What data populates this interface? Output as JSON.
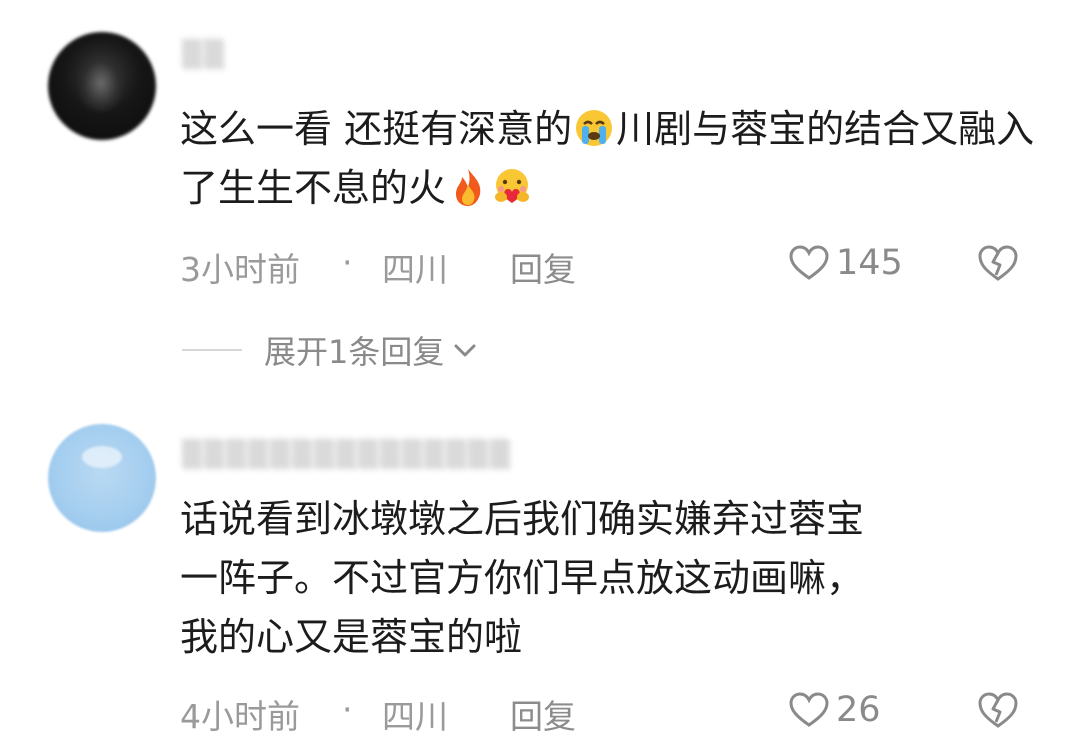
{
  "comments": [
    {
      "username": "▒▒",
      "text": [
        "这么一看 还挺有深意的",
        "川剧与蓉宝的结合又融入了生生不息的火",
        ""
      ],
      "emojis": [
        "crying-face-emoji",
        "fire-emoji",
        "heart-hug-emoji"
      ],
      "time": "3小时前",
      "separator": "·",
      "region": "四川",
      "reply_label": "回复",
      "likes": "145",
      "expand_label": "展开1条回复"
    },
    {
      "username": "▒▒▒▒▒▒▒▒▒▒▒▒▒▒▒",
      "text_lines": [
        "话说看到冰墩墩之后我们确实嫌弃过蓉宝",
        "一阵子。不过官方你们早点放这动画嘛，",
        "我的心又是蓉宝的啦"
      ],
      "time": "4小时前",
      "separator": "·",
      "region": "四川",
      "reply_label": "回复",
      "likes": "26"
    }
  ],
  "colors": {
    "text": "#1c1c1c",
    "meta": "#9a9a9a",
    "divider": "#d6d6d6"
  }
}
